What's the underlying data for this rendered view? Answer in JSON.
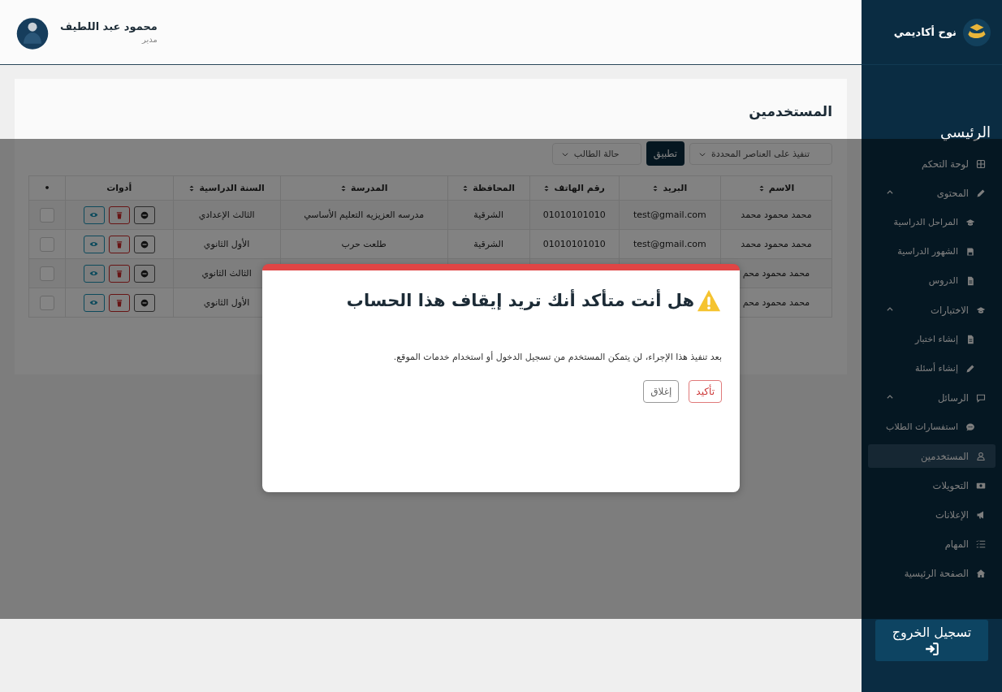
{
  "header": {
    "user_name": "محمود عبد اللطيف",
    "user_role": "مدير"
  },
  "sidebar": {
    "brand": "نوح أكاديمي",
    "section_title": "الرئيسي",
    "items": [
      {
        "label": "لوحة التحكم",
        "selected": false
      },
      {
        "label": "المحتوى",
        "selected": false,
        "expanded": true,
        "children": [
          {
            "label": "المراحل الدراسية",
            "selected": false
          },
          {
            "label": "الشهور الدراسية",
            "selected": false
          },
          {
            "label": "الدروس",
            "selected": false
          }
        ]
      },
      {
        "label": "الاختبارات",
        "selected": false,
        "expanded": true,
        "children": [
          {
            "label": "إنشاء اختبار",
            "selected": false
          },
          {
            "label": "إنشاء أسئلة",
            "selected": false
          }
        ]
      },
      {
        "label": "الرسائل",
        "selected": false,
        "expanded": true,
        "children": [
          {
            "label": "استفسارات الطلاب",
            "selected": false
          }
        ]
      },
      {
        "label": "المستخدمين",
        "selected": true
      },
      {
        "label": "التحويلات",
        "selected": false
      },
      {
        "label": "الإعلانات",
        "selected": false
      },
      {
        "label": "المهام",
        "selected": false
      },
      {
        "label": "الصفحة الرئيسية",
        "selected": false
      }
    ],
    "logout": "تسجيل الخروج"
  },
  "page": {
    "title": "المستخدمين",
    "bulk_action": "تنفيذ على العناصر المحددة",
    "apply_button": "تطبيق",
    "status_filter": "حالة الطالب"
  },
  "table": {
    "columns": [
      {
        "label": "الاسم",
        "sortable": true
      },
      {
        "label": "البريد",
        "sortable": true
      },
      {
        "label": "رقم الهاتف",
        "sortable": true
      },
      {
        "label": "المحافظة",
        "sortable": true
      },
      {
        "label": "المدرسة",
        "sortable": true
      },
      {
        "label": "السنة الدراسية",
        "sortable": true
      },
      {
        "label": "أدوات",
        "sortable": false
      },
      {
        "label": "•",
        "sortable": false
      }
    ],
    "rows": [
      {
        "name": "محمد محمود محمد",
        "email": "test@gmail.com",
        "phone": "01010101010",
        "governorate": "الشرقية",
        "school": "مدرسه العزيزيه التعليم الأساسي",
        "year": "الثالث الإعدادي",
        "checked": false
      },
      {
        "name": "محمد محمود محمد",
        "email": "test@gmail.com",
        "phone": "01010101010",
        "governorate": "الشرقية",
        "school": "طلعت حرب",
        "year": "الأول الثانوي",
        "checked": false
      },
      {
        "name": "محمد محمود محم",
        "year": "الثالث الثانوي",
        "checked": false
      },
      {
        "name": "محمد محمود محم",
        "year": "الأول الثانوي",
        "checked": false
      }
    ]
  },
  "dialog": {
    "title": "هل أنت متأكد أنك تريد إيقاف هذا الحساب",
    "message": "بعد تنفيذ هذا الإجراء، لن يتمكن المستخدم من تسجيل الدخول أو استخدام خدمات الموقع.",
    "buttons": [
      {
        "label": "تأكيد",
        "kind": "danger"
      },
      {
        "label": "إغلاق",
        "kind": "secondary"
      }
    ]
  }
}
